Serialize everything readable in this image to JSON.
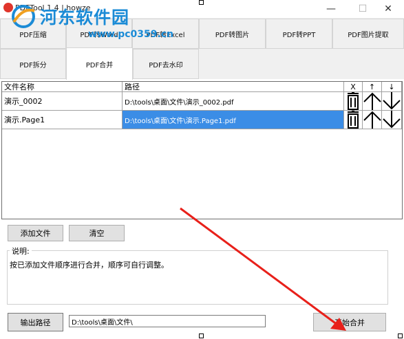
{
  "window": {
    "title": "PDFTool 1.4 | howze",
    "minimize_glyph": "—",
    "maximize_glyph": "☐",
    "close_glyph": "✕"
  },
  "watermark": {
    "name": "河东软件园",
    "url": "www.pc0359.cn"
  },
  "tabs_row1": [
    "PDF压缩",
    "PDF转Word",
    "PDF转Excel",
    "PDF转图片",
    "PDF转PPT",
    "PDF图片提取"
  ],
  "tabs_row2": [
    "PDF拆分",
    "PDF合并",
    "PDF去水印"
  ],
  "active_tab": "PDF合并",
  "table": {
    "columns": [
      "文件名称",
      "路径",
      "X",
      "↑",
      "↓"
    ],
    "rows": [
      {
        "name": "演示_0002",
        "path": "D:\\tools\\桌面\\文件\\演示_0002.pdf"
      },
      {
        "name": "演示.Page1",
        "path": "D:\\tools\\桌面\\文件\\演示.Page1.pdf"
      }
    ],
    "icons": {
      "delete": "trash-icon",
      "up": "arrow-up-icon",
      "down": "arrow-down-icon"
    }
  },
  "buttons": {
    "add_file": "添加文件",
    "clear": "清空",
    "output_path": "输出路径",
    "start_merge": "开始合并"
  },
  "description": {
    "title": "说明:",
    "text": "按已添加文件顺序进行合并，顺序可自行调整。"
  },
  "output_path_value": "D:\\tools\\桌面\\文件\\",
  "colors": {
    "selection": "#3b8de6",
    "watermark": "#1b8bd6",
    "annotation_arrow": "#e8201a"
  }
}
